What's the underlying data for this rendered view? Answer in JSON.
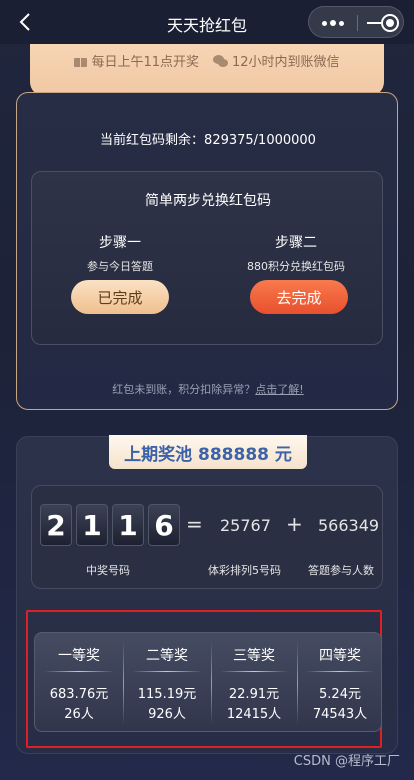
{
  "nav": {
    "title": "天天抢红包"
  },
  "banner": {
    "item1": "每日上午11点开奖",
    "item2": "12小时内到账微信"
  },
  "redeem": {
    "remaining_label": "当前红包码剩余：",
    "remaining_value": "829375/1000000",
    "box_title": "简单两步兑换红包码",
    "step1": {
      "name": "步骤一",
      "desc": "参与今日答题",
      "button": "已完成"
    },
    "step2": {
      "name": "步骤二",
      "desc": "880积分兑换红包码",
      "button": "去完成"
    },
    "note": "红包未到账，积分扣除异常？",
    "note_link": "点击了解!"
  },
  "pool": {
    "title": "上期奖池 888888 元",
    "digits": [
      "2",
      "1",
      "1",
      "6"
    ],
    "equals": "=",
    "plus": "+",
    "lottery_number": "25767",
    "participants": "566349",
    "label_winning": "中奖号码",
    "label_lottery": "体彩排列5号码",
    "label_participants": "答题参与人数"
  },
  "prizes": [
    {
      "name": "一等奖",
      "amount": "683.76元",
      "count": "26人"
    },
    {
      "name": "二等奖",
      "amount": "115.19元",
      "count": "926人"
    },
    {
      "name": "三等奖",
      "amount": "22.91元",
      "count": "12415人"
    },
    {
      "name": "四等奖",
      "amount": "5.24元",
      "count": "74543人"
    }
  ],
  "watermark": "CSDN @程序工厂",
  "colors": {
    "accent_gold": "#c9a684",
    "accent_orange": "#e8502d",
    "pool_blue": "#3c62a7",
    "highlight_red": "#e02020"
  }
}
